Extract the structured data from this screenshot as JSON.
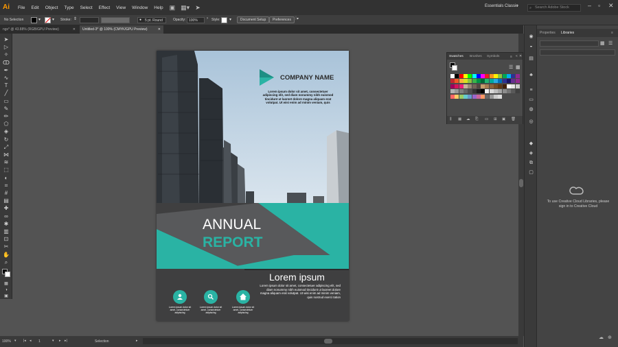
{
  "menubar": {
    "logo": "Ai",
    "items": [
      "File",
      "Edit",
      "Object",
      "Type",
      "Select",
      "Effect",
      "View",
      "Window",
      "Help"
    ],
    "workspace": "Essentials Classic",
    "search_placeholder": "Search Adobe Stock"
  },
  "controlbar": {
    "selection": "No Selection",
    "stroke_label": "Stroke:",
    "brush": "5 pt. Round",
    "opacity_label": "Opacity:",
    "opacity_value": "100%",
    "style_label": "Style:",
    "document_setup": "Document Setup",
    "preferences": "Preferences"
  },
  "tabs": [
    {
      "label": "ngs* @ 43.88% (RGB/GPU Preview)"
    },
    {
      "label": "Untitled-3* @ 100% (CMYK/GPU Preview)"
    }
  ],
  "status": {
    "zoom": "100%",
    "artboard": "1",
    "tool": "Selection"
  },
  "swatches_panel": {
    "tabs": [
      "Swatches",
      "Brushes",
      "Symbols"
    ]
  },
  "libraries_panel": {
    "tabs": [
      "Properties",
      "Libraries"
    ],
    "message": "To use Creative Cloud Libraries, please sign in to Creative Cloud"
  },
  "document": {
    "company_name": "COMPANY NAME",
    "company_body": "Lorem ipsum dolor sit amet, consectetuer adipiscing elit, sed diam nonummy nibh euismod tincidunt ut laoreet dolore magna aliquam erat volutpat. Ut wisi enim ad minim veniam, quis",
    "annual": "ANNUAL",
    "report": "REPORT",
    "lorem_title": "Lorem ipsum",
    "lorem_body": "Lorem ipsum dolor sit amet, consectetuer adipiscing elit, sed diam nonummy nibh euismod tincidunt ut laoreet dolore magna aliquam erat volutpat. Ut wisi enim ad minim veniam, quis nostrud exerci tation",
    "icon_captions": [
      "Lorem ipsum dolor sit amet, consectetuer adipiscing",
      "Lorem ipsum dolor sit amet, consectetuer adipiscing",
      "Lorem ipsum dolor sit amet, consectetuer adipiscing"
    ],
    "colors": {
      "teal": "#2ab3a4",
      "dark": "#3f3f40",
      "sky": "#b9cfe0"
    }
  },
  "icons": {
    "toolbar": [
      "selection-tool-icon",
      "direct-selection-tool-icon",
      "magic-wand-icon",
      "lasso-icon",
      "pen-tool-icon",
      "curvature-tool-icon",
      "type-tool-icon",
      "line-tool-icon",
      "rectangle-tool-icon",
      "paintbrush-icon",
      "pencil-icon",
      "shaper-icon",
      "eraser-icon",
      "rotate-icon",
      "scale-icon",
      "width-icon",
      "warp-icon",
      "free-transform-icon",
      "shape-builder-icon",
      "perspective-icon",
      "mesh-icon",
      "gradient-icon",
      "eyedropper-icon",
      "blend-icon",
      "symbol-sprayer-icon",
      "graph-icon",
      "artboard-icon",
      "slice-icon",
      "hand-icon",
      "zoom-icon"
    ],
    "document_circles": [
      "user-icon",
      "search-icon",
      "home-icon"
    ]
  }
}
